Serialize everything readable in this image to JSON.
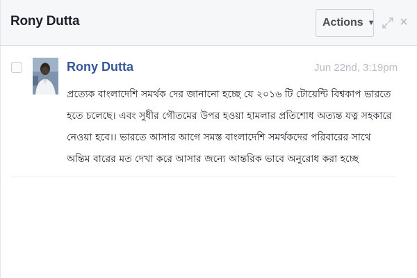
{
  "header": {
    "title": "Rony Dutta",
    "actions_label": "Actions",
    "actions_caret": "▼",
    "close_glyph": "×"
  },
  "message": {
    "sender": "Rony Dutta",
    "timestamp": "Jun 22nd, 3:19pm",
    "body": "প্রত্যেক বাংলাদেশি সমর্থক দের জানানো হচ্ছে যে ২০১৬ টি টোয়েন্টি বিশ্বকাপ ভারতে হতে চলেছে। এবং সুধীর গৌতমের উপর হওয়া হামলার প্রতিশোধ অত্যন্ত যত্ন সহকারে নেওয়া হবে।। ভারতে আসার আগে সমস্ত বাংলাদেশি সমর্থকদের পরিবারের সাথে অন্তিম বারের মত দেখা করে আসার জন্যে আন্তরিক ভাবে অনুরোধ করা হচ্ছে"
  },
  "icons": {
    "dropdown": "chevron-down-icon",
    "expand": "expand-icon",
    "close": "close-icon",
    "avatar": "profile-photo"
  },
  "colors": {
    "link": "#365899",
    "timestamp": "#b8bcc4",
    "header_bg": "#f6f7f9"
  }
}
